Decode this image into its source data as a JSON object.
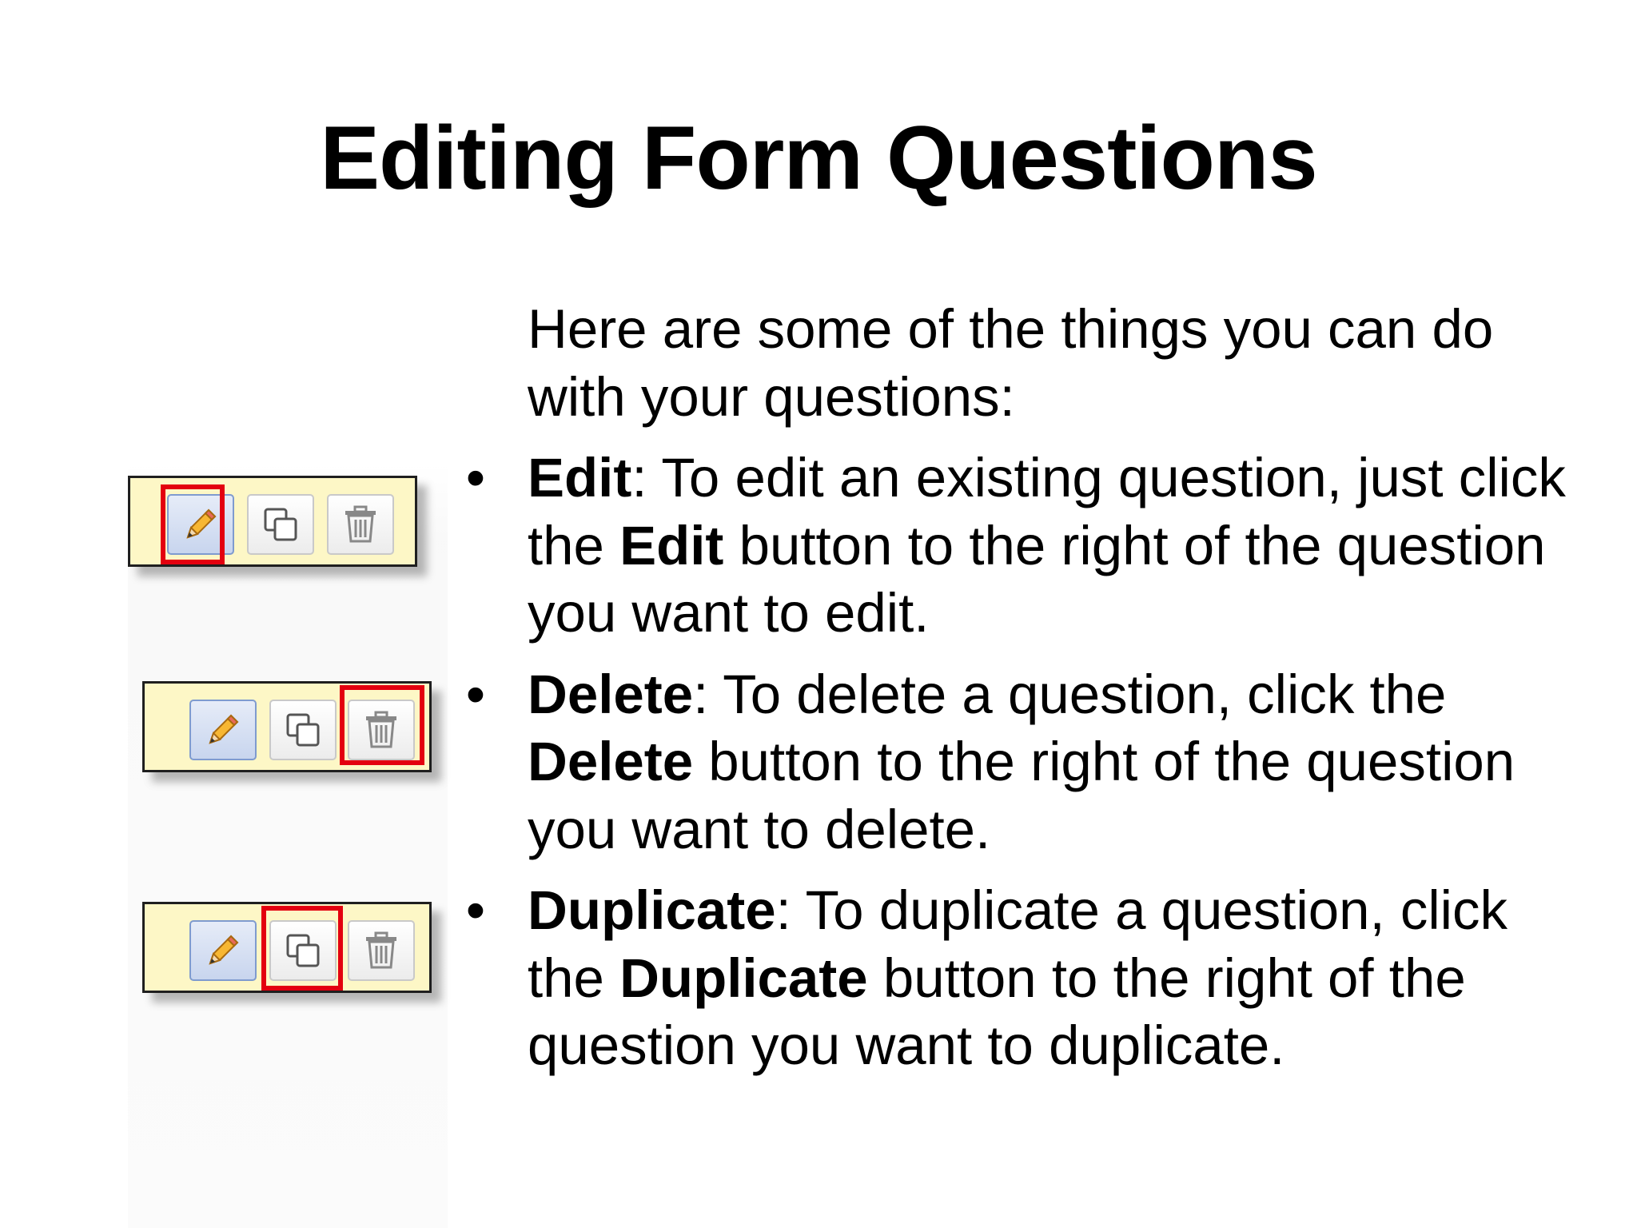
{
  "slide": {
    "title": "Editing Form Questions",
    "intro": "Here are some of the things you can do with your questions:",
    "bullets": [
      {
        "term": "Edit",
        "text_1": ": To edit an existing question, just click the ",
        "term_inline": "Edit",
        "text_2": " button to the right of the question you want to edit."
      },
      {
        "term": "Delete",
        "text_1": ": To delete a question, click the ",
        "term_inline": "Delete",
        "text_2": " button to the right of the question you want to delete."
      },
      {
        "term": "Duplicate",
        "text_1": ": To duplicate a question, click the ",
        "term_inline": "Duplicate",
        "text_2": " button to the right of the question you want to duplicate."
      }
    ],
    "bullet_glyph": "•"
  },
  "toolbars": [
    {
      "highlighted": "edit-button",
      "buttons": [
        "pencil-icon",
        "duplicate-icon",
        "trash-icon"
      ]
    },
    {
      "highlighted": "delete-button",
      "buttons": [
        "pencil-icon",
        "duplicate-icon",
        "trash-icon"
      ]
    },
    {
      "highlighted": "duplicate-button",
      "buttons": [
        "pencil-icon",
        "duplicate-icon",
        "trash-icon"
      ]
    }
  ],
  "colors": {
    "highlight": "#e3000f",
    "toolbar_background": "#fdf7c6",
    "edit_button": "#c8d5ee"
  }
}
